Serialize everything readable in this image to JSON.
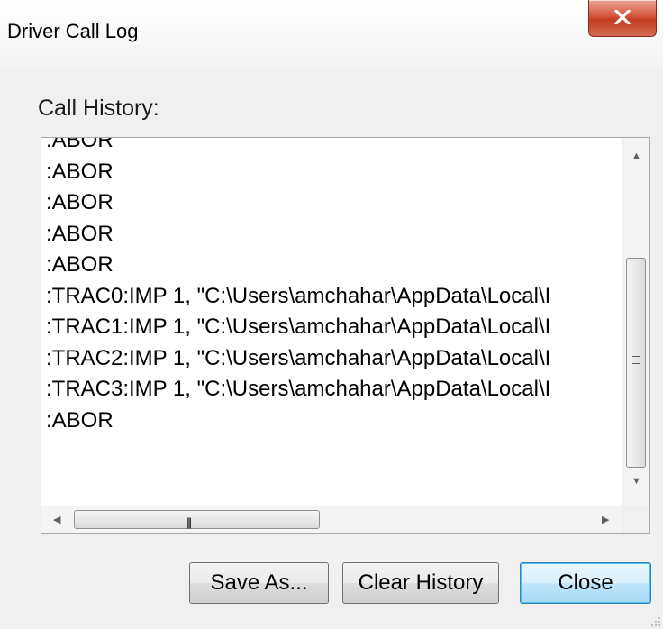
{
  "window": {
    "title": "Driver Call Log",
    "close_glyph": "X"
  },
  "call_history": {
    "label": "Call History:",
    "lines": [
      ":ABOR",
      ":ABOR",
      ":ABOR",
      ":ABOR",
      ":ABOR",
      ":TRAC0:IMP 1, \"C:\\Users\\amchahar\\AppData\\Local\\I",
      ":TRAC1:IMP 1, \"C:\\Users\\amchahar\\AppData\\Local\\I",
      ":TRAC2:IMP 1, \"C:\\Users\\amchahar\\AppData\\Local\\I",
      ":TRAC3:IMP 1, \"C:\\Users\\amchahar\\AppData\\Local\\I",
      ":ABOR"
    ]
  },
  "buttons": {
    "save_as": "Save As...",
    "clear_history": "Clear History",
    "close": "Close"
  },
  "icons": {
    "close": "close-icon",
    "scroll_up": "scroll-up-icon",
    "scroll_down": "scroll-down-icon",
    "scroll_left": "scroll-left-icon",
    "scroll_right": "scroll-right-icon"
  },
  "colors": {
    "close_button": "#c23d22",
    "default_button": "#bee6fd",
    "default_button_border": "#3c7fb1"
  }
}
